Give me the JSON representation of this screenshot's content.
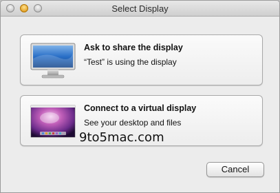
{
  "window": {
    "title": "Select Display"
  },
  "options": [
    {
      "title": "Ask to share the display",
      "subtitle": "“Test” is using the display",
      "icon": "monitor-icon"
    },
    {
      "title": "Connect to a virtual display",
      "subtitle": "See your desktop and files",
      "icon": "desktop-wallpaper-icon"
    }
  ],
  "watermark": "9to5mac.com",
  "buttons": {
    "cancel_label": "Cancel"
  },
  "colors": {
    "window_bg": "#ececec",
    "accent_blue": "#2a6fc7",
    "wallpaper_purple": "#6a2b8a"
  }
}
